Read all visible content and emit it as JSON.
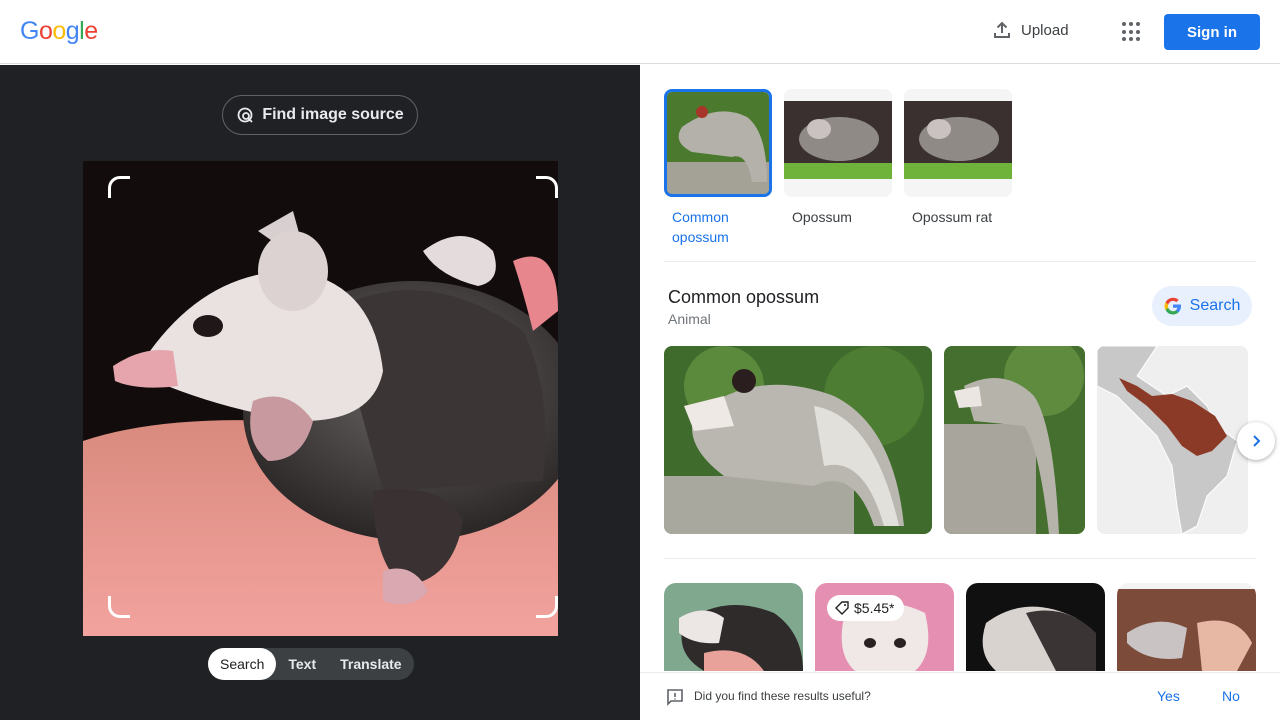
{
  "header": {
    "logo_letters": [
      {
        "ch": "G",
        "color": "#4285f4"
      },
      {
        "ch": "o",
        "color": "#ea4335"
      },
      {
        "ch": "o",
        "color": "#fbbc05"
      },
      {
        "ch": "g",
        "color": "#4285f4"
      },
      {
        "ch": "l",
        "color": "#34a853"
      },
      {
        "ch": "e",
        "color": "#ea4335"
      }
    ],
    "upload_label": "Upload",
    "signin_label": "Sign in",
    "accent": "#1a73e8"
  },
  "left": {
    "find_source_label": "Find image source",
    "modes": [
      {
        "label": "Search",
        "active": true
      },
      {
        "label": "Text",
        "active": false
      },
      {
        "label": "Translate",
        "active": false
      }
    ]
  },
  "right": {
    "chips": [
      {
        "label": "Common opossum",
        "active": true
      },
      {
        "label": "Opossum",
        "active": false
      },
      {
        "label": "Opossum rat",
        "active": false
      }
    ],
    "entity": {
      "title": "Common opossum",
      "subtitle": "Animal",
      "search_label": "Search"
    },
    "results": [
      {
        "price": ""
      },
      {
        "price": "$5.45*"
      },
      {
        "price": ""
      },
      {
        "price": ""
      }
    ]
  },
  "feedback": {
    "question": "Did you find these results useful?",
    "yes": "Yes",
    "no": "No"
  }
}
